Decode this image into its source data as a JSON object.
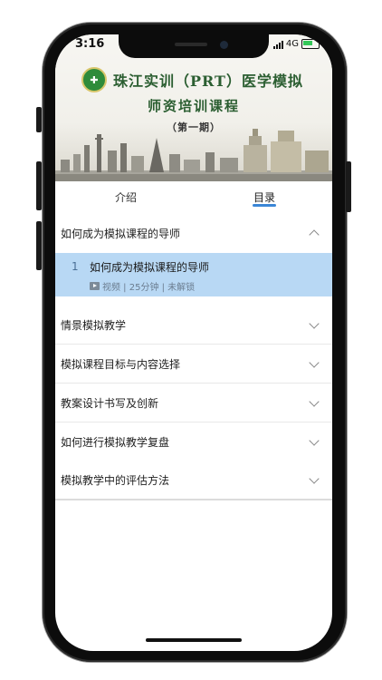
{
  "status_bar": {
    "time": "3:16",
    "network": "4G"
  },
  "banner": {
    "title_line1": "珠江实训（PRT）医学模拟",
    "title_line2": "师资培训课程",
    "title_line3": "（第一期）"
  },
  "tabs": [
    {
      "label": "介绍",
      "active": false
    },
    {
      "label": "目录",
      "active": true
    }
  ],
  "catalog": {
    "expanded_section": "如何成为模拟课程的导师",
    "lesson": {
      "number": "1",
      "title": "如何成为模拟课程的导师",
      "meta": "视频 | 25分钟 | 未解锁"
    },
    "sections": [
      "情景模拟教学",
      "模拟课程目标与内容选择",
      "教案设计书写及创新",
      "如何进行模拟教学复盘",
      "模拟教学中的评估方法"
    ]
  },
  "colors": {
    "accent": "#3b86d6",
    "selected_row": "#b8d8f4",
    "title_green": "#2b5e31"
  }
}
